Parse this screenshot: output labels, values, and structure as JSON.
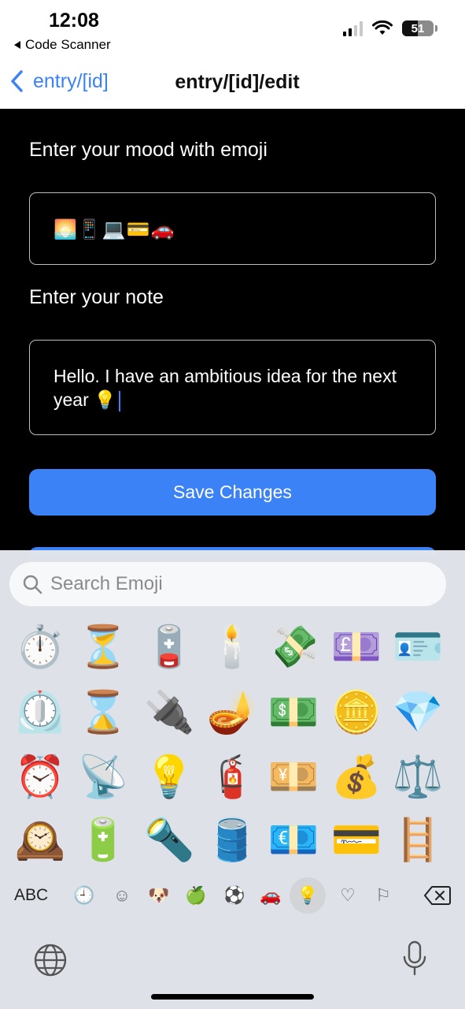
{
  "status": {
    "time": "12:08",
    "back_app": "Code Scanner",
    "battery": "51"
  },
  "nav": {
    "back_label": "entry/[id]",
    "title": "entry/[id]/edit"
  },
  "form": {
    "mood_label": "Enter your mood with emoji",
    "mood_value": "🌅📱💻💳🚗",
    "note_label": "Enter your note",
    "note_value": "Hello. I have an ambitious idea for the next year 💡",
    "save_label": "Save Changes"
  },
  "keyboard": {
    "search_placeholder": "Search Emoji",
    "emoji_grid": [
      [
        "⏱️",
        "⏳",
        "🪫",
        "🕯️",
        "💸",
        "💷",
        "🪪"
      ],
      [
        "⏲️",
        "⌛",
        "🔌",
        "🪔",
        "💵",
        "🪙",
        "💎"
      ],
      [
        "⏰",
        "📡",
        "💡",
        "🧯",
        "💴",
        "💰",
        "⚖️"
      ],
      [
        "🕰️",
        "🔋",
        "🔦",
        "🛢️",
        "💶",
        "💳",
        "🪜"
      ]
    ],
    "categories": [
      {
        "icon": "abc",
        "label": "ABC"
      },
      {
        "icon": "clock-icon",
        "label": "🕘"
      },
      {
        "icon": "smiley-icon",
        "label": "☺"
      },
      {
        "icon": "animal-icon",
        "label": "🐶"
      },
      {
        "icon": "food-icon",
        "label": "🍏"
      },
      {
        "icon": "activity-icon",
        "label": "⚽"
      },
      {
        "icon": "travel-icon",
        "label": "🚗"
      },
      {
        "icon": "objects-icon",
        "label": "💡"
      },
      {
        "icon": "symbols-icon",
        "label": "♡"
      },
      {
        "icon": "flags-icon",
        "label": "⚐"
      }
    ],
    "active_category": "objects-icon"
  },
  "colors": {
    "accent": "#3b82f6",
    "background": "#000000",
    "border": "#bdbdbd"
  }
}
